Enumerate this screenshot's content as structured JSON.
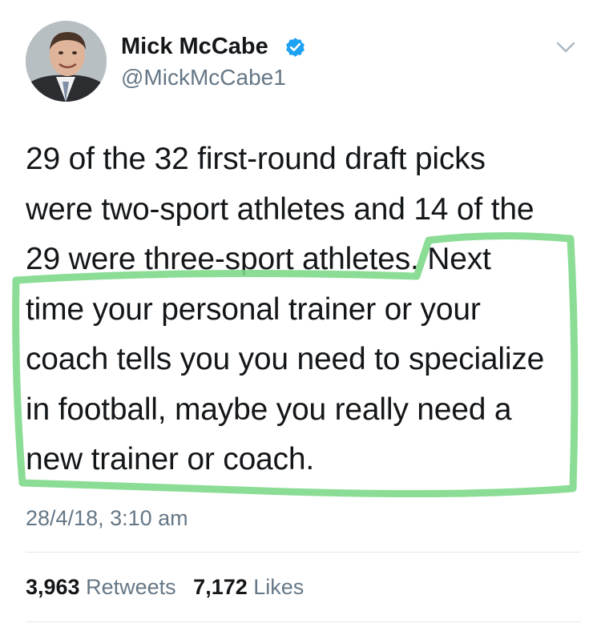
{
  "author": {
    "display_name": "Mick McCabe",
    "handle": "@MickMcCabe1",
    "verified": true,
    "avatar_icon": "person-photo-avatar"
  },
  "tweet": {
    "lines": [
      "29 of the 32 first-round draft picks",
      "were two-sport athletes and 14 of the",
      "29 were three-sport athletes. Next",
      "time your personal trainer or your",
      "coach tells you you need to specialize",
      "in football, maybe you really need a",
      "new trainer or coach."
    ],
    "timestamp": "28/4/18, 3:10 am"
  },
  "stats": {
    "retweets_count": "3,963",
    "retweets_label": "Retweets",
    "likes_count": "7,172",
    "likes_label": "Likes"
  },
  "colors": {
    "verified_badge": "#1da1f2",
    "secondary_text": "#657786",
    "highlight_marker": "#7ed98a"
  },
  "icons": {
    "verified": "verified-badge-icon",
    "menu": "chevron-down-icon"
  }
}
